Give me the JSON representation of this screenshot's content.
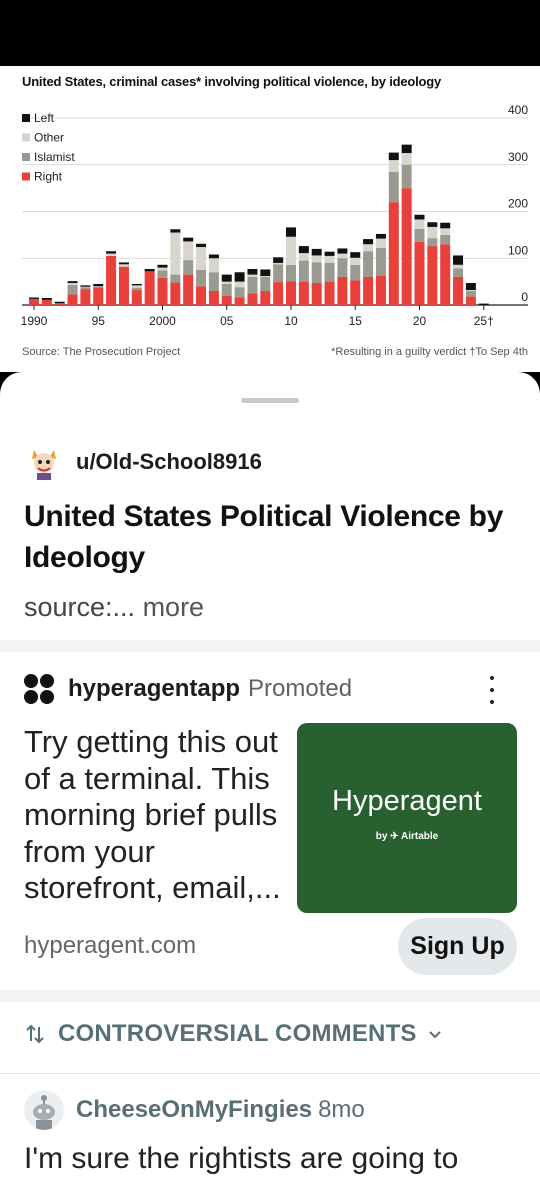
{
  "chart_data": {
    "type": "bar",
    "stacked": true,
    "title": "United States, criminal cases* involving political violence, by ideology",
    "legend_position": "top-left",
    "legend": [
      "Left",
      "Other",
      "Islamist",
      "Right"
    ],
    "colors": {
      "Left": "#111111",
      "Other": "#d7d5cd",
      "Islamist": "#9b9a90",
      "Right": "#e8403a"
    },
    "x": [
      1990,
      1991,
      1992,
      1993,
      1994,
      1995,
      1996,
      1997,
      1998,
      1999,
      2000,
      2001,
      2002,
      2003,
      2004,
      2005,
      2006,
      2007,
      2008,
      2009,
      2010,
      2011,
      2012,
      2013,
      2014,
      2015,
      2016,
      2017,
      2018,
      2019,
      2020,
      2021,
      2022,
      2023,
      2024,
      2025
    ],
    "x_tick_labels": [
      "1990",
      "95",
      "2000",
      "05",
      "10",
      "15",
      "20",
      "25†"
    ],
    "x_tick_years": [
      1990,
      1995,
      2000,
      2005,
      2010,
      2015,
      2020,
      2025
    ],
    "y_ticks": [
      0,
      100,
      200,
      300,
      400
    ],
    "ylim": [
      0,
      400
    ],
    "grid": true,
    "series": [
      {
        "name": "Right",
        "values": [
          13,
          11,
          4,
          23,
          34,
          38,
          105,
          82,
          32,
          72,
          58,
          48,
          65,
          40,
          30,
          20,
          16,
          25,
          30,
          49,
          51,
          50,
          47,
          50,
          60,
          53,
          60,
          62,
          220,
          250,
          135,
          126,
          130,
          60,
          18,
          0
        ]
      },
      {
        "name": "Islamist",
        "values": [
          0,
          0,
          0,
          20,
          4,
          0,
          0,
          0,
          5,
          0,
          16,
          17,
          31,
          35,
          40,
          25,
          22,
          35,
          30,
          38,
          35,
          45,
          44,
          40,
          40,
          33,
          55,
          60,
          65,
          50,
          28,
          17,
          20,
          18,
          12,
          0
        ]
      },
      {
        "name": "Other",
        "values": [
          0,
          0,
          0,
          4,
          1,
          2,
          5,
          5,
          5,
          0,
          6,
          90,
          40,
          49,
          30,
          5,
          12,
          5,
          2,
          3,
          60,
          16,
          15,
          15,
          10,
          15,
          15,
          20,
          25,
          25,
          20,
          24,
          14,
          8,
          2,
          0
        ]
      },
      {
        "name": "Left",
        "values": [
          3,
          4,
          3,
          4,
          3,
          5,
          5,
          4,
          3,
          5,
          6,
          7,
          8,
          7,
          8,
          15,
          20,
          12,
          14,
          12,
          20,
          15,
          14,
          9,
          11,
          12,
          11,
          10,
          16,
          18,
          10,
          10,
          12,
          20,
          15,
          3
        ]
      }
    ],
    "source": "Source: The Prosecution Project",
    "note": "*Resulting in a guilty verdict †To Sep 4th"
  },
  "post": {
    "author": "u/Old-School8916",
    "title": "United States Political Violence by Ideology",
    "body": "source:...",
    "more": "more"
  },
  "ad": {
    "name": "hyperagentapp",
    "promoted": "Promoted",
    "text": "Try getting this out of a terminal. This morning brief pulls from your storefront, email,...",
    "image_title": "Hyperagent",
    "image_sub": "by ✈ Airtable",
    "domain": "hyperagent.com",
    "cta": "Sign Up",
    "brand_color": "#28602f"
  },
  "comments": {
    "sort_label": "CONTROVERSIAL COMMENTS",
    "first": {
      "user": "CheeseOnMyFingies",
      "age": "8mo",
      "text": "I'm sure the rightists are going to"
    }
  }
}
